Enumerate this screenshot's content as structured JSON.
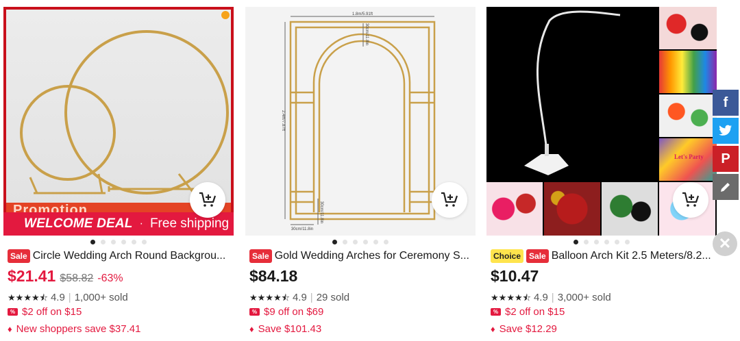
{
  "products": [
    {
      "promo_text": "Promotion",
      "deal_title": "WELCOME DEAL",
      "deal_dot": "·",
      "deal_subtitle": "Free shipping",
      "badges": [
        "Sale"
      ],
      "title": "Circle Wedding Arch Round Backgrou...",
      "price": "$21.41",
      "old_price": "$58.82",
      "discount": "-63%",
      "rating": "4.9",
      "sold": "1,000+ sold",
      "coupon": "$2 off on $15",
      "save": "New shoppers save $37.41"
    },
    {
      "image_labels": {
        "width": "1.8m/5.91ft",
        "top": "30cm/11.8in",
        "height": "2.4m/7.87ft",
        "base_width": "30cm/11.8in",
        "base_depth": "30cm/11.8in"
      },
      "badges": [
        "Sale"
      ],
      "title": "Gold Wedding Arches for Ceremony S...",
      "price": "$84.18",
      "rating": "4.9",
      "sold": "29 sold",
      "coupon": "$9 off on $69",
      "save": "Save $101.43"
    },
    {
      "thumb_text": "Let's Party",
      "badges": [
        "Choice",
        "Sale"
      ],
      "title": "Balloon Arch Kit 2.5 Meters/8.2...",
      "price": "$10.47",
      "rating": "4.9",
      "sold": "3,000+ sold",
      "coupon": "$2 off on $15",
      "save": "Save $12.29"
    }
  ],
  "social": {
    "facebook": "f",
    "pinterest": "P"
  },
  "colors": {
    "accent": "#e3193f",
    "facebook": "#3b5998",
    "twitter": "#1da1f2",
    "pinterest": "#cb2027"
  }
}
